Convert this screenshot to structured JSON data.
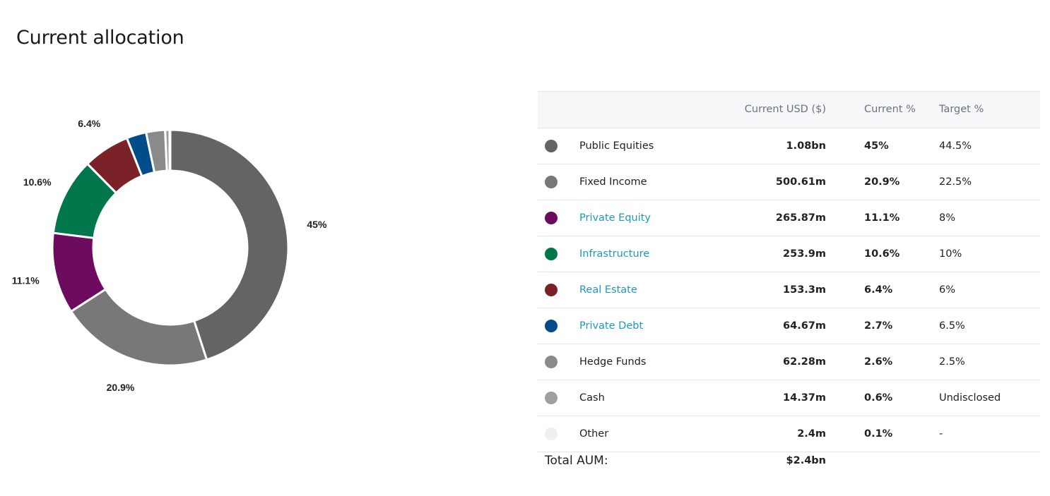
{
  "page": {
    "title": "Current allocation"
  },
  "table": {
    "headers": {
      "name": "",
      "usd": "Current USD ($)",
      "current": "Current %",
      "target": "Target %"
    },
    "rows": [
      {
        "name": "Public Equities",
        "usd": "1.08bn",
        "current": "45%",
        "target": "44.5%",
        "color": "#646464",
        "link": false
      },
      {
        "name": "Fixed Income",
        "usd": "500.61m",
        "current": "20.9%",
        "target": "22.5%",
        "color": "#787878",
        "link": false
      },
      {
        "name": "Private Equity",
        "usd": "265.87m",
        "current": "11.1%",
        "target": "8%",
        "color": "#6d0b5e",
        "link": true
      },
      {
        "name": "Infrastructure",
        "usd": "253.9m",
        "current": "10.6%",
        "target": "10%",
        "color": "#00774a",
        "link": true
      },
      {
        "name": "Real Estate",
        "usd": "153.3m",
        "current": "6.4%",
        "target": "6%",
        "color": "#7b2228",
        "link": true
      },
      {
        "name": "Private Debt",
        "usd": "64.67m",
        "current": "2.7%",
        "target": "6.5%",
        "color": "#024c8a",
        "link": true
      },
      {
        "name": "Hedge Funds",
        "usd": "62.28m",
        "current": "2.6%",
        "target": "2.5%",
        "color": "#8a8a8a",
        "link": false
      },
      {
        "name": "Cash",
        "usd": "14.37m",
        "current": "0.6%",
        "target": "Undisclosed",
        "color": "#a0a0a0",
        "link": false
      },
      {
        "name": "Other",
        "usd": "2.4m",
        "current": "0.1%",
        "target": "-",
        "color": "#efefef",
        "link": false
      }
    ],
    "total": {
      "label": "Total AUM:",
      "value": "$2.4bn"
    }
  },
  "chart_data": {
    "type": "pie",
    "categories": [
      "Public Equities",
      "Fixed Income",
      "Private Equity",
      "Infrastructure",
      "Real Estate",
      "Private Debt",
      "Hedge Funds",
      "Cash",
      "Other"
    ],
    "values": [
      45,
      20.9,
      11.1,
      10.6,
      6.4,
      2.7,
      2.6,
      0.6,
      0.1
    ],
    "colors": [
      "#646464",
      "#787878",
      "#6d0b5e",
      "#00774a",
      "#7b2228",
      "#024c8a",
      "#8a8a8a",
      "#a0a0a0",
      "#efefef"
    ],
    "labels": [
      "45%",
      "20.9%",
      "11.1%",
      "10.6%",
      "6.4%",
      "",
      "",
      "",
      ""
    ],
    "title": ""
  }
}
